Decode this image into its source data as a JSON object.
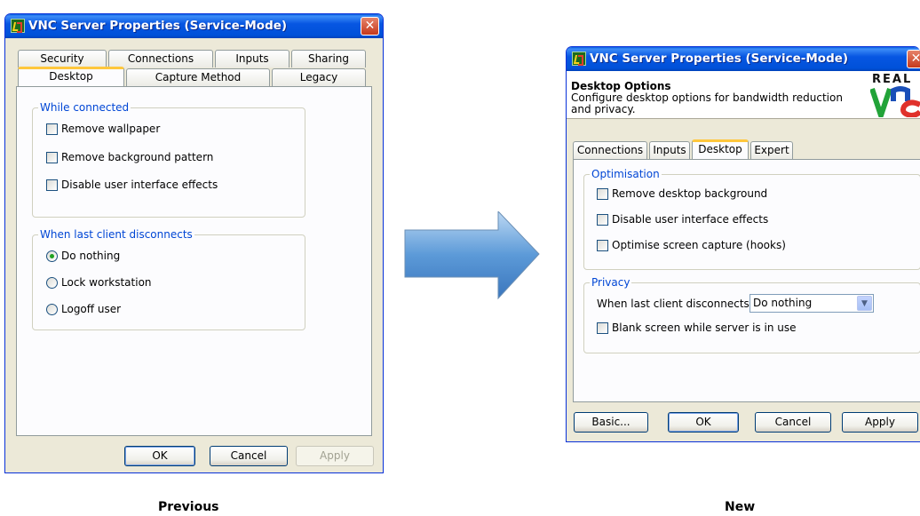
{
  "old_window": {
    "title": "VNC Server Properties (Service-Mode)",
    "close": "✕",
    "tabs_row1": [
      "Security",
      "Connections",
      "Inputs",
      "Sharing"
    ],
    "tabs_row2": [
      "Desktop",
      "Capture Method",
      "Legacy"
    ],
    "active_tab": "Desktop",
    "group_connected": {
      "legend": "While connected",
      "options": [
        "Remove wallpaper",
        "Remove background pattern",
        "Disable user interface effects"
      ]
    },
    "group_disconnect": {
      "legend": "When last client disconnects",
      "options": [
        "Do nothing",
        "Lock workstation",
        "Logoff user"
      ],
      "selected": "Do nothing"
    },
    "buttons": {
      "ok": "OK",
      "cancel": "Cancel",
      "apply": "Apply"
    }
  },
  "new_window": {
    "title": "VNC Server Properties (Service-Mode)",
    "close": "✕",
    "header": {
      "title": "Desktop Options",
      "description": "Configure desktop options for bandwidth reduction and privacy.",
      "logo_text": "REAL"
    },
    "tabs": [
      "Connections",
      "Inputs",
      "Desktop",
      "Expert"
    ],
    "active_tab": "Desktop",
    "group_optimisation": {
      "legend": "Optimisation",
      "options": [
        "Remove desktop background",
        "Disable user interface effects",
        "Optimise screen capture (hooks)"
      ]
    },
    "group_privacy": {
      "legend": "Privacy",
      "disconnect_label": "When last client disconnects",
      "disconnect_value": "Do nothing",
      "blank_screen": "Blank screen while server is in use"
    },
    "buttons": {
      "basic": "Basic...",
      "ok": "OK",
      "cancel": "Cancel",
      "apply": "Apply"
    }
  },
  "captions": {
    "previous": "Previous",
    "new": "New"
  },
  "colors": {
    "titlebar": "#0054e3",
    "legend": "#0046d5",
    "arrow": "#4a8fd0",
    "tab_accent": "#ffc73c"
  }
}
